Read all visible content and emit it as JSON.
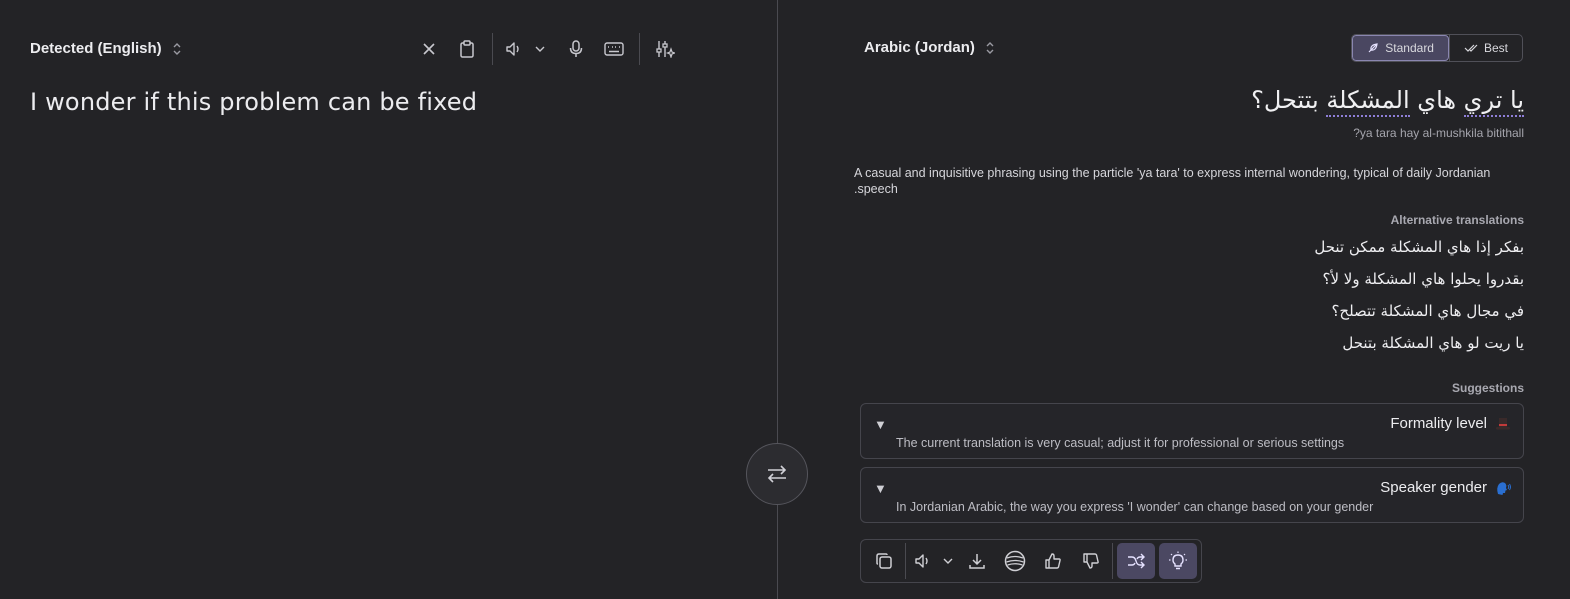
{
  "source": {
    "language_label": "Detected (English)",
    "text": "I wonder if this problem can be fixed"
  },
  "target": {
    "language_label": "Arabic (Jordan)",
    "quality": {
      "standard_label": "Standard",
      "best_label": "Best",
      "selected": "Standard"
    },
    "translation_part1": "يا تري",
    "translation_part2": " هاي ",
    "translation_part3": "المشكلة",
    "translation_part4": " بتتحل؟",
    "transliteration": "ya tara hay al-mushkila bitithall?",
    "explanation": "A casual and inquisitive phrasing using the particle 'ya tara' to express internal wondering, typical of daily Jordanian speech.",
    "alternatives_heading": "Alternative translations",
    "alternatives": [
      "بفكر إذا هاي المشكلة ممكن تنحل",
      "بقدروا يحلوا هاي المشكلة ولا لأ؟",
      "في مجال هاي المشكلة تتصلح؟",
      "يا ريت لو هاي المشكلة بتنحل"
    ],
    "suggestions_heading": "Suggestions",
    "suggestions": [
      {
        "title": "Formality level",
        "icon": "top-hat-icon",
        "description": "The current translation is very casual; adjust it for professional or serious settings"
      },
      {
        "title": "Speaker gender",
        "icon": "speaking-head-icon",
        "description": "In Jordanian Arabic, the way you express 'I wonder' can change based on your gender"
      }
    ]
  },
  "colors": {
    "background": "#232326",
    "accent": "#4b4862",
    "underline": "#8f7fd8"
  }
}
